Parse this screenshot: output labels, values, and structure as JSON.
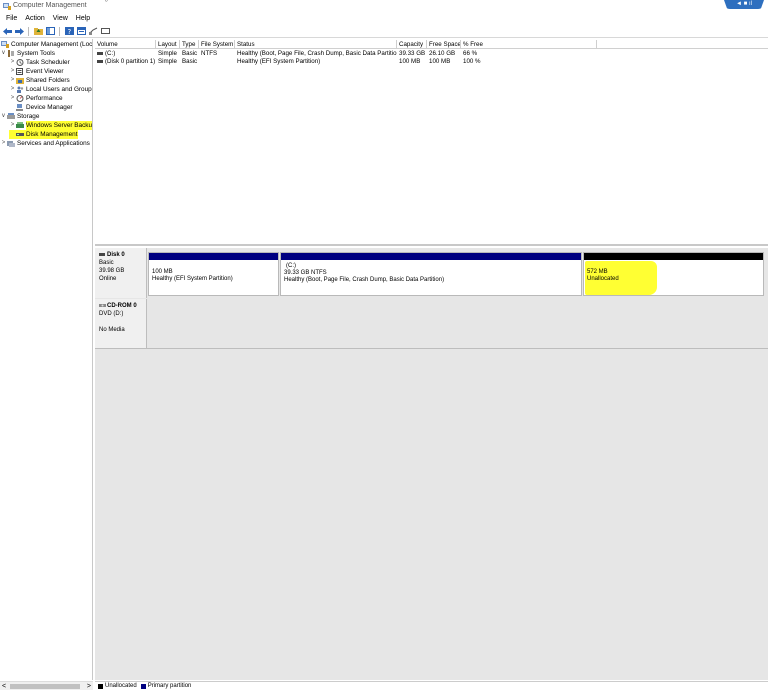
{
  "window": {
    "title": "Computer Management",
    "title_caret": "ᵒ",
    "remote_badge": "◄ ■ ıl"
  },
  "menu": [
    "File",
    "Action",
    "View",
    "Help"
  ],
  "tree": {
    "items": [
      {
        "label": "Computer Management (Local",
        "twisty": "",
        "icon": "computer-management-icon",
        "indent": 0
      },
      {
        "label": "System Tools",
        "twisty": "∨",
        "icon": "tools-icon",
        "indent": 1
      },
      {
        "label": "Task Scheduler",
        "twisty": ">",
        "icon": "clock-icon",
        "indent": 2
      },
      {
        "label": "Event Viewer",
        "twisty": ">",
        "icon": "event-viewer-icon",
        "indent": 2
      },
      {
        "label": "Shared Folders",
        "twisty": ">",
        "icon": "shared-folder-icon",
        "indent": 2
      },
      {
        "label": "Local Users and Groups",
        "twisty": ">",
        "icon": "users-icon",
        "indent": 2
      },
      {
        "label": "Performance",
        "twisty": ">",
        "icon": "performance-icon",
        "indent": 2
      },
      {
        "label": "Device Manager",
        "twisty": "",
        "icon": "device-manager-icon",
        "indent": 2
      },
      {
        "label": "Storage",
        "twisty": "∨",
        "icon": "storage-icon",
        "indent": 1
      },
      {
        "label": "Windows Server Backup",
        "twisty": ">",
        "icon": "backup-icon",
        "indent": 2
      },
      {
        "label": "Disk Management",
        "twisty": "",
        "icon": "disk-icon",
        "indent": 2
      },
      {
        "label": "Services and Applications",
        "twisty": ">",
        "icon": "services-icon",
        "indent": 1
      }
    ],
    "scroll_left": "<",
    "scroll_right": ">"
  },
  "volume_table": {
    "headers": [
      "Volume",
      "Layout",
      "Type",
      "File System",
      "Status",
      "Capacity",
      "Free Space",
      "% Free"
    ],
    "rows": [
      [
        "(C:)",
        "Simple",
        "Basic",
        "NTFS",
        "Healthy (Boot, Page File, Crash Dump, Basic Data Partition)",
        "39.33 GB",
        "26.10 GB",
        "66 %"
      ],
      [
        "(Disk 0 partition 1)",
        "Simple",
        "Basic",
        "",
        "Healthy (EFI System Partition)",
        "100 MB",
        "100 MB",
        "100 %"
      ]
    ]
  },
  "disks": [
    {
      "name": "Disk 0",
      "type": "Basic",
      "size": "39.98 GB",
      "state": "Online",
      "partitions": [
        {
          "title": "",
          "size": "100 MB",
          "status": "Healthy (EFI System Partition)",
          "bar_color": "#000080"
        },
        {
          "title": "(C:)",
          "size": "39.33 GB NTFS",
          "status": "Healthy (Boot, Page File, Crash Dump, Basic Data Partition)",
          "bar_color": "#000080"
        },
        {
          "title": "",
          "size": "572 MB",
          "status": "Unallocated",
          "bar_color": "#000000"
        }
      ]
    },
    {
      "name": "CD-ROM 0",
      "type": "DVD (D:)",
      "size": "",
      "state": "No Media"
    }
  ],
  "legend": [
    {
      "label": "Unallocated",
      "color": "#000000"
    },
    {
      "label": "Primary partition",
      "color": "#000080"
    }
  ],
  "colors": {
    "highlight": "#ffff33",
    "primary_partition": "#000080",
    "unallocated": "#000000"
  }
}
